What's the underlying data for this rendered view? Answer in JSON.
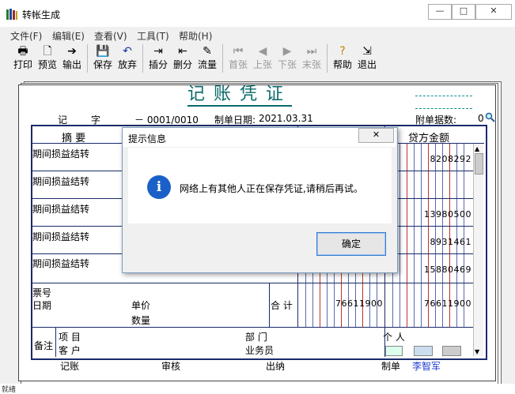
{
  "window": {
    "title": "转帐生成",
    "minimize": "—",
    "maximize": "□",
    "close": "✕"
  },
  "menu": [
    "文件(F)",
    "编辑(E)",
    "查看(V)",
    "工具(T)",
    "帮助(H)"
  ],
  "toolbar": {
    "print": {
      "label": "打印",
      "icon": "printer-icon"
    },
    "preview": {
      "label": "预览",
      "icon": "preview-icon"
    },
    "export": {
      "label": "输出",
      "icon": "export-icon"
    },
    "save": {
      "label": "保存",
      "icon": "save-icon"
    },
    "discard": {
      "label": "放弃",
      "icon": "undo-icon"
    },
    "insert_entry": {
      "label": "插分",
      "icon": "insert-row-icon"
    },
    "delete_entry": {
      "label": "删分",
      "icon": "delete-row-icon"
    },
    "flow": {
      "label": "流量",
      "icon": "flow-icon"
    },
    "first": {
      "label": "首张",
      "icon": "first-icon"
    },
    "prev": {
      "label": "上张",
      "icon": "prev-icon"
    },
    "next": {
      "label": "下张",
      "icon": "next-icon"
    },
    "last": {
      "label": "末张",
      "icon": "last-icon"
    },
    "help": {
      "label": "帮助",
      "icon": "help-icon"
    },
    "exit": {
      "label": "退出",
      "icon": "exit-icon"
    }
  },
  "voucher": {
    "title": "记账凭证",
    "type_label": "记",
    "char_label": "字",
    "number": "－ 0001/0010",
    "date_label": "制单日期:",
    "date": "2021.03.31",
    "attachments_label": "附单据数:",
    "attachments": "0",
    "col_summary": "摘 要",
    "col_credit": "贷方金额",
    "rows": [
      {
        "summary": "期间损益结转",
        "credit": "8208292"
      },
      {
        "summary": "期间损益结转",
        "credit": ""
      },
      {
        "summary": "期间损益结转",
        "credit": "13980500"
      },
      {
        "summary": "期间损益结转",
        "credit": "8931461"
      },
      {
        "summary": "期间损益结转",
        "credit": "15880469"
      }
    ],
    "ticket_no_label": "票号",
    "date_row_label": "日期",
    "unit_price_label": "单价",
    "quantity_label": "数量",
    "total_label": "合 计",
    "debit_total": "76611900",
    "credit_total": "76611900",
    "remark_label": "备注",
    "project_label": "项 目",
    "customer_label": "客 户",
    "department_label": "部 门",
    "salesperson_label": "业务员",
    "person_label": "个 人",
    "bookkeeper_label": "记账",
    "reviewer_label": "审核",
    "cashier_label": "出纳",
    "maker_label": "制单",
    "maker_name": "李智军"
  },
  "dialog": {
    "title": "提示信息",
    "close": "✕",
    "message": "网络上有其他人正在保存凭证,请稍后再试。",
    "ok_label": "确定"
  },
  "status": {
    "text": "就绪"
  },
  "colors": {
    "title_teal": "#0a6a6a",
    "grid_navy": "#1a2a6a",
    "maker_blue": "#1a3ad0",
    "dialog_icon_blue": "#1a60c8"
  }
}
